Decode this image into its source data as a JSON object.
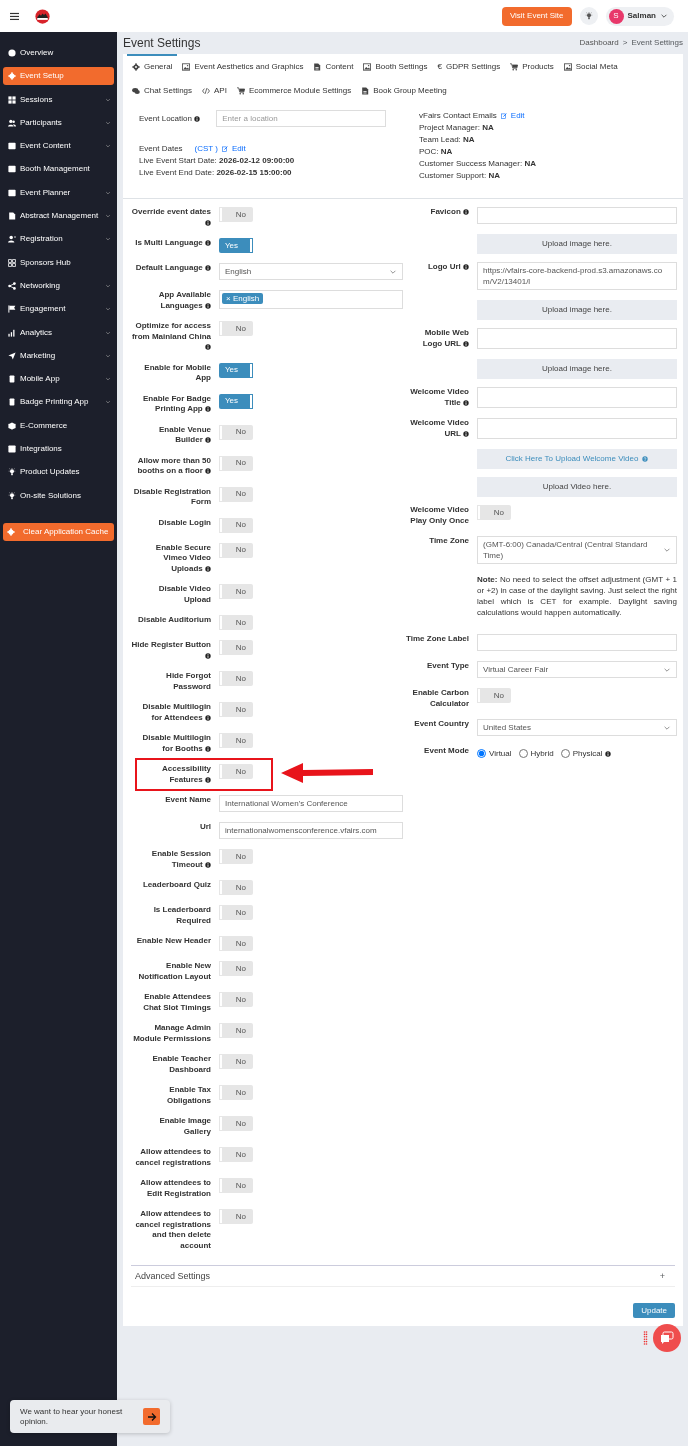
{
  "topbar": {
    "visit_button": "Visit Event Site",
    "user": {
      "initial": "S",
      "name": "Salman"
    }
  },
  "sidebar": {
    "items": [
      {
        "label": "Overview",
        "selected": false,
        "has_children": false
      },
      {
        "label": "Event Setup",
        "selected": true,
        "has_children": false
      },
      {
        "label": "Sessions",
        "selected": false,
        "has_children": true
      },
      {
        "label": "Participants",
        "selected": false,
        "has_children": true
      },
      {
        "label": "Event Content",
        "selected": false,
        "has_children": true
      },
      {
        "label": "Booth Management",
        "selected": false,
        "has_children": false
      },
      {
        "label": "Event Planner",
        "selected": false,
        "has_children": true
      },
      {
        "label": "Abstract Management",
        "selected": false,
        "has_children": true
      },
      {
        "label": "Registration",
        "selected": false,
        "has_children": true
      },
      {
        "label": "Sponsors Hub",
        "selected": false,
        "has_children": false
      },
      {
        "label": "Networking",
        "selected": false,
        "has_children": true
      },
      {
        "label": "Engagement",
        "selected": false,
        "has_children": true
      },
      {
        "label": "Analytics",
        "selected": false,
        "has_children": true
      },
      {
        "label": "Marketing",
        "selected": false,
        "has_children": true
      },
      {
        "label": "Mobile App",
        "selected": false,
        "has_children": true
      },
      {
        "label": "Badge Printing App",
        "selected": false,
        "has_children": true
      },
      {
        "label": "E-Commerce",
        "selected": false,
        "has_children": false
      },
      {
        "label": "Integrations",
        "selected": false,
        "has_children": false
      },
      {
        "label": "Product Updates",
        "selected": false,
        "has_children": false
      },
      {
        "label": "On-site Solutions",
        "selected": false,
        "has_children": false
      }
    ],
    "clear_cache_button": "Clear Application Cache"
  },
  "header": {
    "title": "Event Settings",
    "breadcrumb": [
      "Dashboard",
      "Event Settings"
    ],
    "breadcrumb_separator": ">"
  },
  "tabs": [
    {
      "label": "General",
      "selected": true
    },
    {
      "label": "Event Aesthetics and Graphics",
      "selected": false
    },
    {
      "label": "Content",
      "selected": false
    },
    {
      "label": "Booth Settings",
      "selected": false
    },
    {
      "label": "GDPR Settings",
      "glyph": "€",
      "selected": false
    },
    {
      "label": "Products",
      "selected": false
    },
    {
      "label": "Social Meta",
      "selected": false
    },
    {
      "label": "Chat Settings",
      "selected": false
    },
    {
      "label": "API",
      "selected": false
    },
    {
      "label": "Ecommerce Module Settings",
      "selected": false
    },
    {
      "label": "Book Group Meeting",
      "selected": false
    }
  ],
  "location": {
    "label": "Event Location",
    "placeholder": "Enter a location"
  },
  "dates": {
    "label": "Event Dates",
    "timezone": "(CST )",
    "edit": "Edit",
    "lines": [
      {
        "label": "Live Event Start Date:",
        "value": "2026-02-12 09:00:00"
      },
      {
        "label": "Live Event End Date:",
        "value": "2026-02-15 15:00:00"
      }
    ]
  },
  "contacts": {
    "title": "vFairs Contact Emails",
    "edit": "Edit",
    "lines": [
      {
        "label": "Project Manager:",
        "value": "NA"
      },
      {
        "label": "Team Lead:",
        "value": "NA"
      },
      {
        "label": "POC:",
        "value": "NA"
      },
      {
        "label": "Customer Success Manager:",
        "value": "NA"
      },
      {
        "label": "Customer Support:",
        "value": "NA"
      }
    ]
  },
  "left_fields": [
    {
      "kind": "toggle",
      "label": "Override event dates",
      "info": true,
      "on": false,
      "text": "No"
    },
    {
      "kind": "toggle",
      "label": "Is Multi Language",
      "info": true,
      "on": true,
      "text": "Yes"
    },
    {
      "kind": "select",
      "label": "Default Language",
      "info": true,
      "value": "English"
    },
    {
      "kind": "tags",
      "label": "App Available Languages",
      "info": true,
      "tags": [
        {
          "remove": "×",
          "label": "English"
        }
      ]
    },
    {
      "kind": "toggle",
      "label": "Optimize for access from Mainland China",
      "info": true,
      "on": false,
      "text": "No"
    },
    {
      "kind": "toggle",
      "label": "Enable for Mobile App",
      "info": false,
      "on": true,
      "text": "Yes"
    },
    {
      "kind": "toggle",
      "label": "Enable For Badge Printing App",
      "info": true,
      "on": true,
      "text": "Yes"
    },
    {
      "kind": "toggle",
      "label": "Enable Venue Builder",
      "info": true,
      "on": false,
      "text": "No"
    },
    {
      "kind": "toggle",
      "label": "Allow more than 50 booths on a floor",
      "info": true,
      "on": false,
      "text": "No"
    },
    {
      "kind": "toggle",
      "label": "Disable Registration Form",
      "info": false,
      "on": false,
      "text": "No"
    },
    {
      "kind": "toggle",
      "label": "Disable Login",
      "info": false,
      "on": false,
      "text": "No"
    },
    {
      "kind": "toggle",
      "label": "Enable Secure Vimeo Video Uploads",
      "info": true,
      "on": false,
      "text": "No"
    },
    {
      "kind": "toggle",
      "label": "Disable Video Upload",
      "info": false,
      "on": false,
      "text": "No"
    },
    {
      "kind": "toggle",
      "label": "Disable Auditorium",
      "info": false,
      "on": false,
      "text": "No"
    },
    {
      "kind": "toggle",
      "label": "Hide Register Button",
      "info": true,
      "on": false,
      "text": "No"
    },
    {
      "kind": "toggle",
      "label": "Hide Forgot Password",
      "info": false,
      "on": false,
      "text": "No"
    },
    {
      "kind": "toggle",
      "label": "Disable Multilogin for Attendees",
      "info": true,
      "on": false,
      "text": "No"
    },
    {
      "kind": "toggle",
      "label": "Disable Multilogin for Booths",
      "info": true,
      "on": false,
      "text": "No"
    },
    {
      "kind": "toggle",
      "label": "Accessibility Features",
      "info": true,
      "on": false,
      "text": "No",
      "highlighted": true
    },
    {
      "kind": "text",
      "label": "Event Name",
      "info": false,
      "value": "International Women's Conference"
    },
    {
      "kind": "text",
      "label": "Url",
      "info": false,
      "value": "internationalwomensconference.vfairs.com"
    },
    {
      "kind": "toggle",
      "label": "Enable Session Timeout",
      "info": true,
      "on": false,
      "text": "No"
    },
    {
      "kind": "toggle",
      "label": "Leaderboard Quiz",
      "info": false,
      "on": false,
      "text": "No"
    },
    {
      "kind": "toggle",
      "label": "Is Leaderboard Required",
      "info": false,
      "on": false,
      "text": "No"
    },
    {
      "kind": "toggle",
      "label": "Enable New Header",
      "info": false,
      "on": false,
      "text": "No"
    },
    {
      "kind": "toggle",
      "label": "Enable New Notification Layout",
      "info": false,
      "on": false,
      "text": "No"
    },
    {
      "kind": "toggle",
      "label": "Enable Attendees Chat Slot Timings",
      "info": false,
      "on": false,
      "text": "No"
    },
    {
      "kind": "toggle",
      "label": "Manage Admin Module Permissions",
      "info": false,
      "on": false,
      "text": "No"
    },
    {
      "kind": "toggle",
      "label": "Enable Teacher Dashboard",
      "info": false,
      "on": false,
      "text": "No"
    },
    {
      "kind": "toggle",
      "label": "Enable Tax Obligations",
      "info": false,
      "on": false,
      "text": "No"
    },
    {
      "kind": "toggle",
      "label": "Enable Image Gallery",
      "info": false,
      "on": false,
      "text": "No"
    },
    {
      "kind": "toggle",
      "label": "Allow attendees to cancel registrations",
      "info": false,
      "on": false,
      "text": "No"
    },
    {
      "kind": "toggle",
      "label": "Allow attendees to Edit Registration",
      "info": false,
      "on": false,
      "text": "No"
    },
    {
      "kind": "toggle",
      "label": "Allow attendees to cancel registrations and then delete account",
      "info": false,
      "on": false,
      "text": "No"
    }
  ],
  "right_fields": [
    {
      "kind": "text",
      "label": "Favicon",
      "info": true
    },
    {
      "kind": "upload",
      "text": "Upload image here."
    },
    {
      "kind": "text",
      "label": "Logo Url",
      "info": true,
      "value": "https://vfairs-core-backend-prod.s3.amazonaws.com/V2/13401/l"
    },
    {
      "kind": "upload",
      "text": "Upload image here."
    },
    {
      "kind": "text",
      "label": "Mobile Web Logo URL",
      "info": true
    },
    {
      "kind": "upload",
      "text": "Upload image here."
    },
    {
      "kind": "text",
      "label": "Welcome Video Title",
      "info": true
    },
    {
      "kind": "text",
      "label": "Welcome Video URL",
      "info": true
    },
    {
      "kind": "link_upload",
      "text": "Click Here To Upload Welcome Video"
    },
    {
      "kind": "upload",
      "text": "Upload Video here."
    },
    {
      "kind": "toggle",
      "label": "Welcome Video Play Only Once",
      "info": false,
      "on": false,
      "text": "No"
    },
    {
      "kind": "select",
      "label": "Time Zone",
      "info": false,
      "value": "(GMT-6:00) Canada/Central (Central Standard Time)"
    },
    {
      "kind": "note",
      "text": "**Note:** No need to select the offset adjustment (GMT + 1 or +2) in case of the daylight saving. Just select the right label which is CET for example. Daylight saving calculations would happen automatically."
    },
    {
      "kind": "text",
      "label": "Time Zone Label",
      "info": false
    },
    {
      "kind": "select",
      "label": "Event Type",
      "info": false,
      "value": "Virtual Career Fair"
    },
    {
      "kind": "toggle",
      "label": "Enable Carbon Calculator",
      "info": false,
      "on": false,
      "text": "No"
    },
    {
      "kind": "select",
      "label": "Event Country",
      "info": false,
      "value": "United States"
    },
    {
      "kind": "radio",
      "label": "Event Mode",
      "info": false,
      "options": [
        {
          "label": "Virtual",
          "selected": true,
          "info": false
        },
        {
          "label": "Hybrid",
          "selected": false,
          "info": false
        },
        {
          "label": "Physical",
          "selected": false,
          "info": true
        }
      ]
    }
  ],
  "advanced": {
    "label": "Advanced Settings",
    "icon_text": "+"
  },
  "update_button": "Update",
  "feedback": {
    "text": "We want to hear your honest opinion."
  }
}
